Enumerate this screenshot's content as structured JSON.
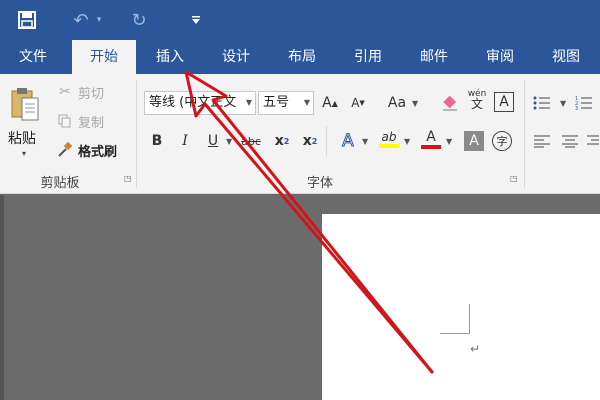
{
  "quick_access": {
    "save_icon": "save-icon",
    "undo_icon": "undo-icon",
    "redo_icon": "redo-icon",
    "customize_icon": "customize-icon"
  },
  "tabs": [
    {
      "label": "文件"
    },
    {
      "label": "开始"
    },
    {
      "label": "插入"
    },
    {
      "label": "设计"
    },
    {
      "label": "布局"
    },
    {
      "label": "引用"
    },
    {
      "label": "邮件"
    },
    {
      "label": "审阅"
    },
    {
      "label": "视图"
    }
  ],
  "clipboard": {
    "paste": "粘贴",
    "cut": "剪切",
    "copy": "复制",
    "format_painter": "格式刷",
    "group_label": "剪贴板"
  },
  "font": {
    "font_name": "等线 (中文正文",
    "font_size": "五号",
    "grow": "A",
    "shrink": "A",
    "change_case": "Aa",
    "pinyin_top": "wén",
    "pinyin_bottom": "文",
    "border_char": "A",
    "bold": "B",
    "italic": "I",
    "underline": "U",
    "strike": "abc",
    "subscript": "x",
    "subscript_mark": "2",
    "superscript": "x",
    "superscript_mark": "2",
    "text_effect": "A",
    "highlight": "ab",
    "font_color": "A",
    "char_shading": "A",
    "enclose": "字",
    "group_label": "字体"
  },
  "document": {
    "paragraph_mark": "↵"
  },
  "colors": {
    "accent": "#2b579a",
    "annotation": "#d0161b",
    "highlight": "#ffff00",
    "font_color": "#d0161b"
  }
}
